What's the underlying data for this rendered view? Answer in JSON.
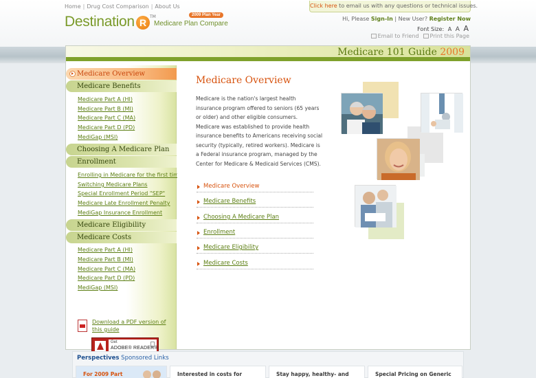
{
  "topnav": {
    "items": [
      "Home",
      "Drug Cost Comparison",
      "About Us"
    ],
    "separator": "|"
  },
  "logo": {
    "word": "Destination",
    "letter": "R",
    "tm": "TM",
    "subtitle": "Medicare Plan Compare",
    "badge": "2009 Plan Year"
  },
  "help": {
    "link": "Click here",
    "text": " to email us with any questions or technical issues."
  },
  "account": {
    "greeting": "Hi, Please ",
    "sign_in": "Sign-In",
    "separator": " | ",
    "new_user": "New User? ",
    "register": "Register Now"
  },
  "font_size": {
    "label": "Font Size:",
    "small": "A",
    "medium": "A",
    "large": "A"
  },
  "tools": {
    "email": "Email to Friend",
    "print": "Print this Page"
  },
  "guide": {
    "title": "Medicare 101 Guide",
    "year": "2009"
  },
  "sidebar": {
    "medicare_overview": "Medicare Overview",
    "medicare_benefits": "Medicare Benefits",
    "benefits_links": [
      "Medicare Part A (HI)",
      "Medicare Part B (MI)",
      "Medicare Part C (MA)",
      "Medicare Part D (PD)",
      "MediGap (MSI)"
    ],
    "choosing_plan": "Choosing A Medicare Plan",
    "enrollment": "Enrollment",
    "enrollment_links": [
      "Enrolling in Medicare for the first time",
      "Switching Medicare Plans",
      "Special Enrollment Period \"SEP\"",
      "Medicare Late Enrollment Penalty",
      "MediGap Insurance Enrollment"
    ],
    "eligibility": "Medicare Eligibility",
    "costs": "Medicare Costs",
    "costs_links": [
      "Medicare Part A (HI)",
      "Medicare Part B (MI)",
      "Medicare Part C (MA)",
      "Medicare Part D (PD)",
      "MediGap (MSI)"
    ],
    "pdf_text": "Download a PDF version of this guide",
    "adobe_get": "Get",
    "adobe_reader": "ADOBE® READER®"
  },
  "main": {
    "title": "Medicare Overview",
    "body": "Medicare is the nation's largest health insurance program offered to seniors (65 years or older) and other eligible consumers.  Medicare was established to provide health insurance benefits to Americans receiving social security (typically, retired workers).  Medicare is a Federal insurance program, managed by the Center for Medicare & Medicaid Services (CMS).",
    "toc": [
      "Medicare Overview",
      "Medicare Benefits",
      "Choosing A Medicare Plan",
      "Enrollment",
      "Medicare Eligibility",
      "Medicare Costs"
    ]
  },
  "perspectives": {
    "title": "Perspectives",
    "subtitle": " Sponsored Links",
    "cards": [
      "For 2009 Part",
      "Interested in costs for",
      "Stay happy, healthy- and",
      "Special Pricing on Generic"
    ]
  },
  "colors": {
    "brand_green": "#7fa12b",
    "accent_orange": "#d7520d",
    "link_green": "#5a7d10"
  }
}
